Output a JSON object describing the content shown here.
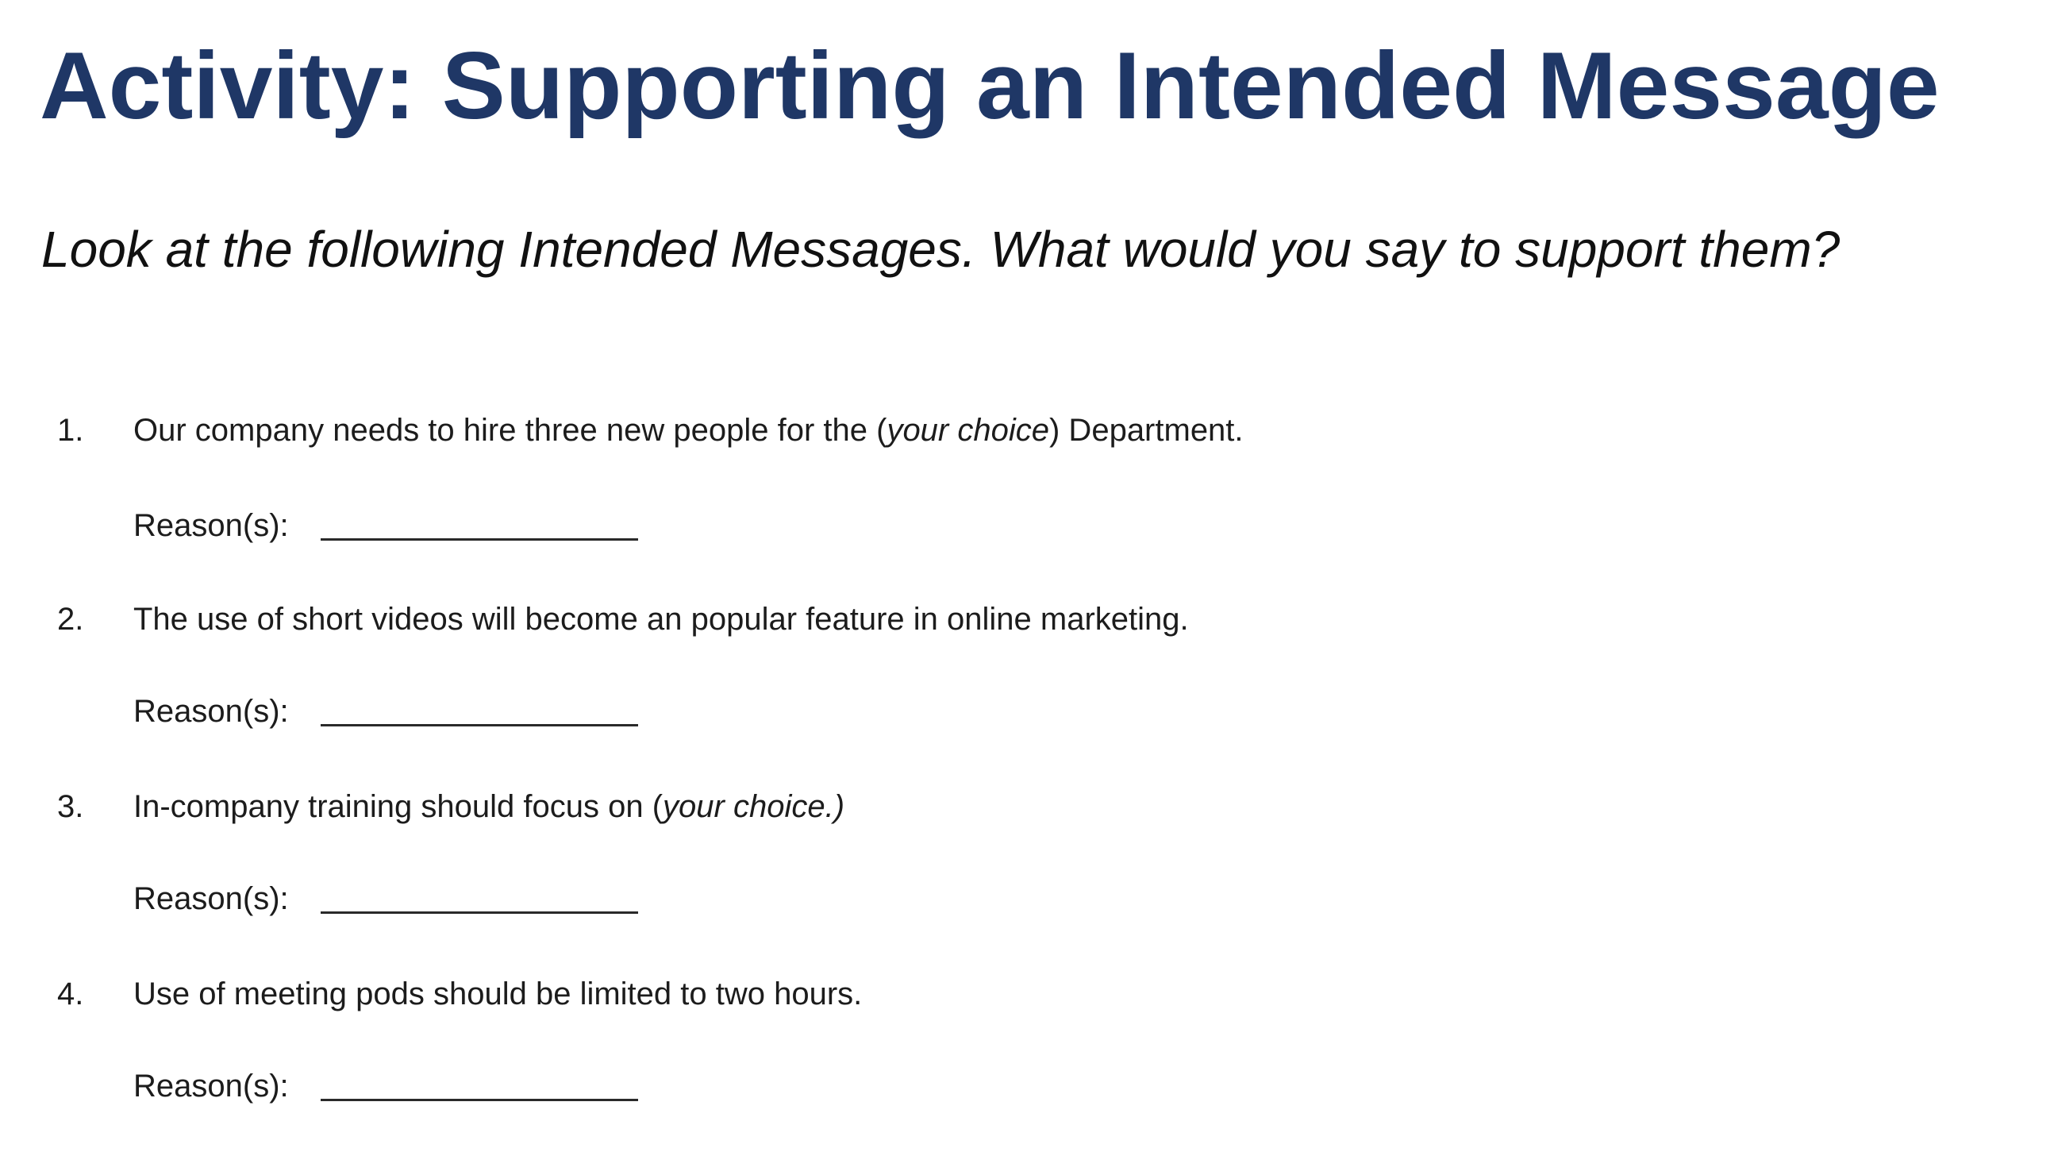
{
  "title": "Activity: Supporting an Intended Message",
  "instruction": "Look at the following Intended Messages. What would you say to support them?",
  "reason_label": "Reason(s):",
  "items": [
    {
      "number": "1.",
      "before": "Our company needs to hire three new people for the (",
      "italic": "your choice",
      "after": ") Department."
    },
    {
      "number": "2.",
      "before": "The use of short videos will become an popular feature in online marketing.",
      "italic": "",
      "after": ""
    },
    {
      "number": "3.",
      "before": "In-company training should focus on (",
      "italic": "your choice.)",
      "after": ""
    },
    {
      "number": "4.",
      "before": "Use of meeting pods should be limited to two hours.",
      "italic": "",
      "after": ""
    }
  ]
}
